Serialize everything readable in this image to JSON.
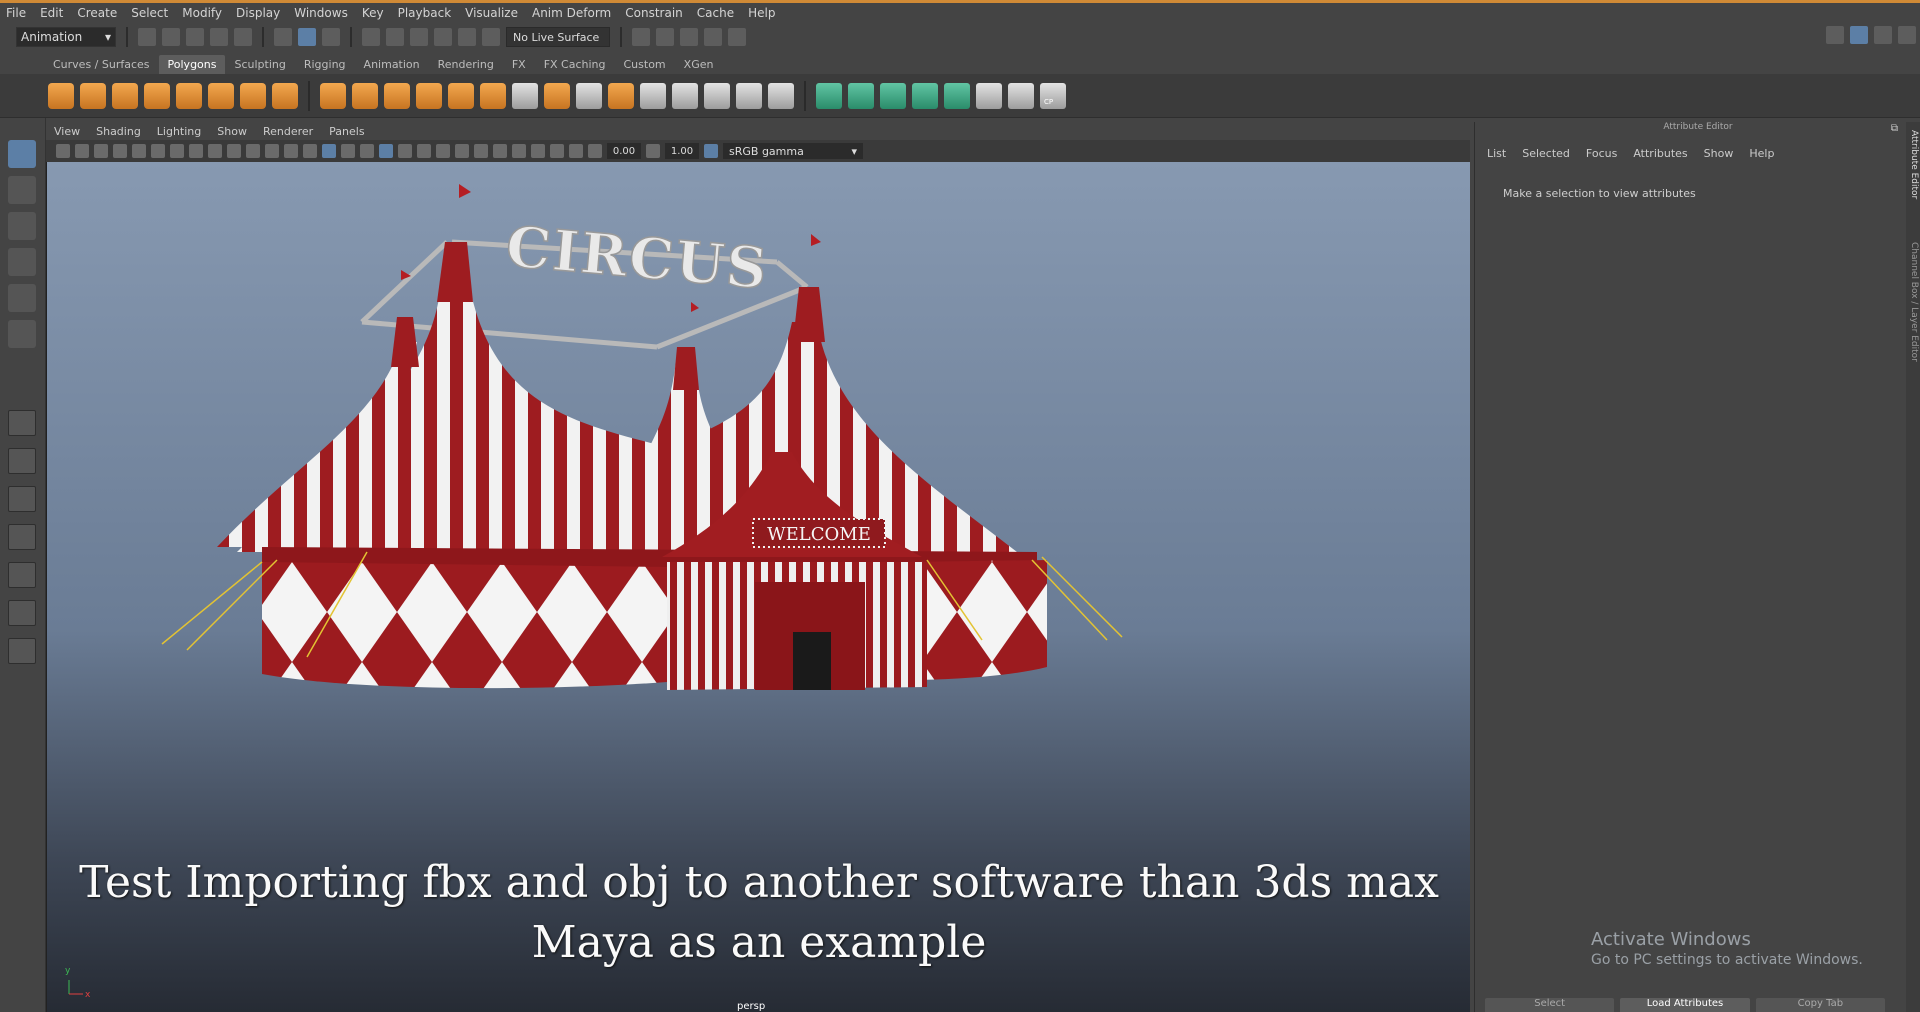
{
  "menus": [
    "File",
    "Edit",
    "Create",
    "Select",
    "Modify",
    "Display",
    "Windows",
    "Key",
    "Playback",
    "Visualize",
    "Anim Deform",
    "Constrain",
    "Cache",
    "Help"
  ],
  "status": {
    "mode": "Animation",
    "live_surface": "No Live Surface"
  },
  "shelf": {
    "tabs": [
      "Curves / Surfaces",
      "Polygons",
      "Sculpting",
      "Rigging",
      "Animation",
      "Rendering",
      "FX",
      "FX Caching",
      "Custom",
      "XGen"
    ],
    "active_tab": "Polygons",
    "side_icon": "⌖",
    "cp_label": "CP"
  },
  "panel": {
    "menus": [
      "View",
      "Shading",
      "Lighting",
      "Show",
      "Renderer",
      "Panels"
    ],
    "exposure": "0.00",
    "gamma_value": "1.00",
    "color_space": "sRGB gamma"
  },
  "viewport": {
    "sign": "CIRCUS",
    "welcome": "WELCOME",
    "caption_line1": "Test Importing fbx and obj to another software than 3ds max",
    "caption_line2": "Maya as an example",
    "camera": "persp",
    "axis_y": "y",
    "axis_x": "x"
  },
  "attribute_editor": {
    "title": "Attribute Editor",
    "menu": [
      "List",
      "Selected",
      "Focus",
      "Attributes",
      "Show",
      "Help"
    ],
    "message": "Make a selection to view attributes",
    "activate_title": "Activate Windows",
    "activate_sub": "Go to PC settings to activate Windows.",
    "buttons": [
      "Select",
      "Load Attributes",
      "Copy Tab"
    ],
    "side_tab1": "Attribute Editor",
    "side_tab2": "Channel Box / Layer Editor"
  },
  "colors": {
    "menu_accent": "#d08a36",
    "tent_red": "#9e1c20",
    "tent_white": "#f2f2f2",
    "selection_blue": "#5c7fa6"
  }
}
